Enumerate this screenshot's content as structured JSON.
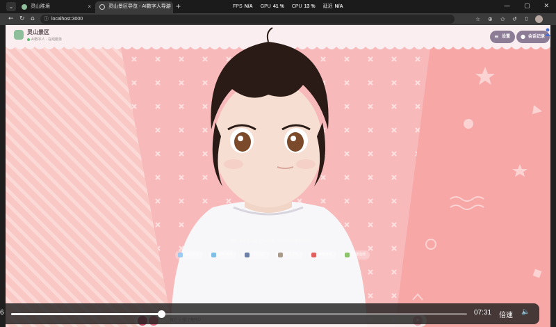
{
  "browser": {
    "tabs": [
      {
        "title": "灵山胜境",
        "close": "×",
        "active": false
      },
      {
        "title": "灵山景区导览 - AI数字人导游",
        "close": "×",
        "active": true
      }
    ],
    "tab_menu": "⌄",
    "new_tab": "+",
    "perf": [
      {
        "label": "FPS",
        "value": "N/A"
      },
      {
        "label": "GPU",
        "value": "41 %"
      },
      {
        "label": "CPU",
        "value": "13 %"
      },
      {
        "label": "延迟",
        "value": "N/A"
      }
    ],
    "window_controls": {
      "minimize": "—",
      "maximize": "▢",
      "close": "✕"
    },
    "nav": {
      "back": "←",
      "reload": "↻",
      "home": "⌂"
    },
    "url": "localhost:3000",
    "url_info": "ⓘ",
    "toolbar": {
      "favorite": "☆",
      "extensions": "⊕",
      "favorites": "✩",
      "history": "↺",
      "share": "⇧"
    }
  },
  "page": {
    "brand": "灵山景区",
    "status": "AI数字人 · 在线服务",
    "settings": {
      "icon": "≡",
      "label": "设置"
    },
    "history": {
      "icon": "●",
      "label": "会话记录"
    },
    "hint": "你好！我是灵山景区的AI导游，有什么可以帮你的吗？",
    "chips": [
      {
        "label": "景区介绍",
        "color": "#9ec9f0"
      },
      {
        "label": "游览路线",
        "color": "#7fbfe6"
      },
      {
        "label": "门票信息",
        "color": "#6d7fa6"
      },
      {
        "label": "历史文化",
        "color": "#a99b8c"
      },
      {
        "label": "美食推荐",
        "color": "#e06060"
      },
      {
        "label": "交通指南",
        "color": "#8cc36b"
      }
    ],
    "input_placeholder": "有什么想了解的?",
    "send": "➤"
  },
  "video": {
    "time_left": "6",
    "time": "07:31",
    "speed": "倍速",
    "volume_icon": "🔈",
    "progress": 0.33
  },
  "colors": {
    "accent": "#8d7c96",
    "page_bg": "#f7b4b4",
    "header_bg": "#fbeef0"
  }
}
